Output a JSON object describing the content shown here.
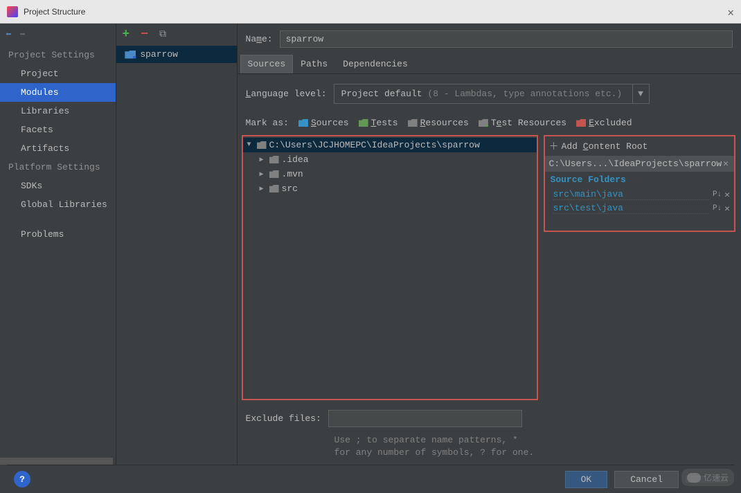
{
  "titlebar": {
    "title": "Project Structure"
  },
  "sidebar": {
    "section1": "Project Settings",
    "section2": "Platform Settings",
    "items": {
      "project": "Project",
      "modules": "Modules",
      "libraries": "Libraries",
      "facets": "Facets",
      "artifacts": "Artifacts",
      "sdks": "SDKs",
      "global_libs": "Global Libraries",
      "problems": "Problems"
    }
  },
  "module_list": {
    "selected": "sparrow"
  },
  "form": {
    "name_label": "Name:",
    "name_value": "sparrow",
    "tabs": {
      "sources": "Sources",
      "paths": "Paths",
      "deps": "Dependencies"
    },
    "lang_label": "Language level:",
    "lang_value": "Project default ",
    "lang_hint": "(8 - Lambdas, type annotations etc.)",
    "mark_label": "Mark as:",
    "mark": {
      "sources": "Sources",
      "tests": "Tests",
      "resources": "Resources",
      "test_res": "Test Resources",
      "excluded": "Excluded"
    }
  },
  "tree": {
    "root": "C:\\Users\\JCJHOMEPC\\IdeaProjects\\sparrow",
    "children": [
      ".idea",
      ".mvn",
      "src"
    ]
  },
  "roots": {
    "add_label": "Add Content Root",
    "path": "C:\\Users...\\IdeaProjects\\sparrow",
    "source_folders_label": "Source Folders",
    "folders": [
      "src\\main\\java",
      "src\\test\\java"
    ]
  },
  "exclude": {
    "label": "Exclude files:",
    "hint1": "Use ; to separate name patterns, *",
    "hint2": "for any number of symbols, ? for one."
  },
  "footer": {
    "ok": "OK",
    "cancel": "Cancel",
    "help": "?"
  },
  "watermark": "亿速云"
}
